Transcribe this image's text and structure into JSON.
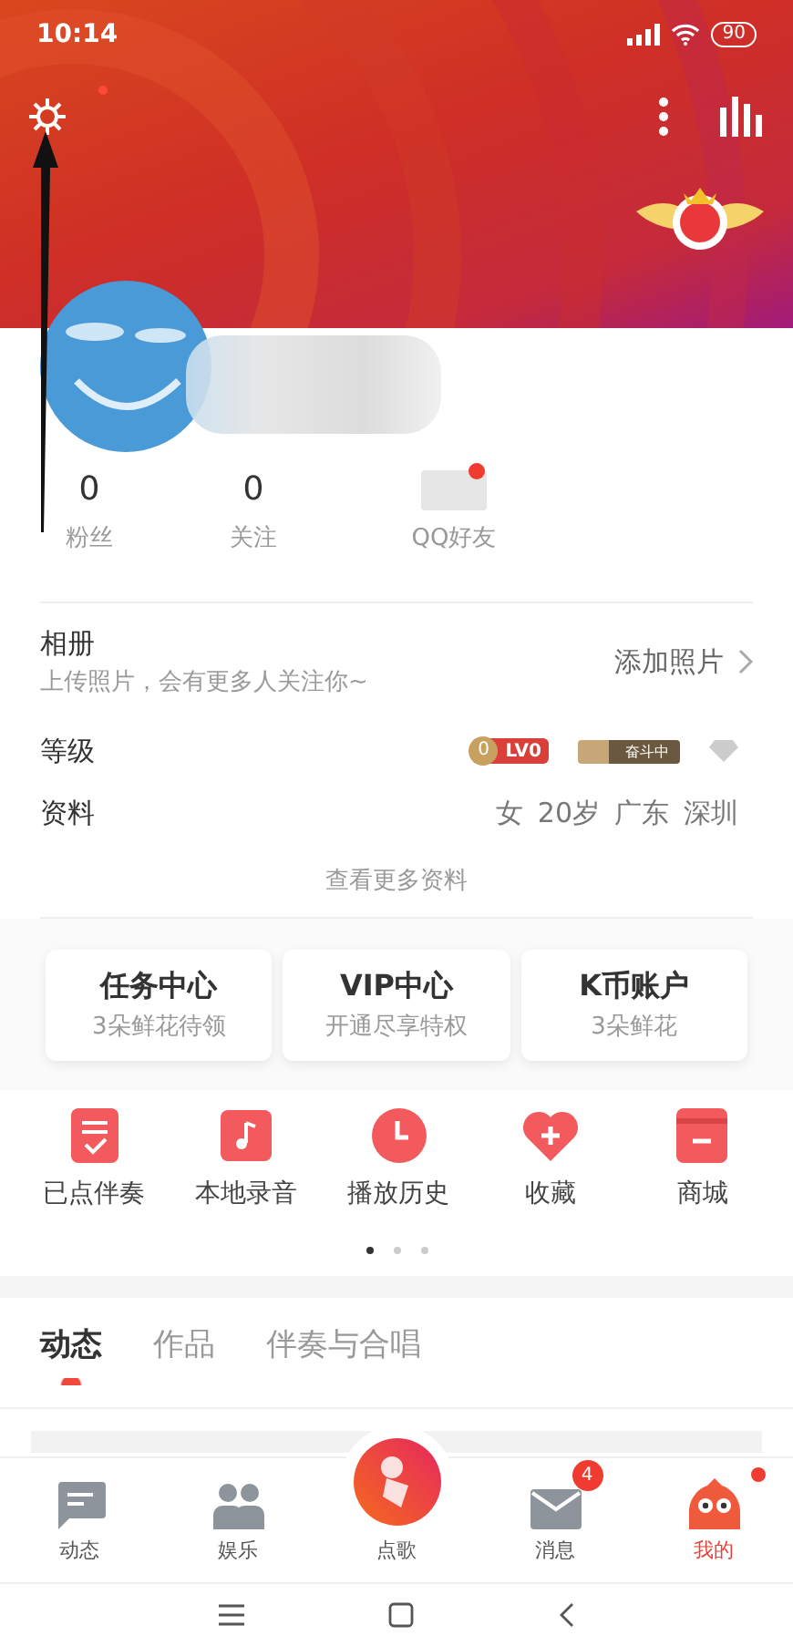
{
  "status_bar": {
    "time": "10:14",
    "battery": "90"
  },
  "header": {
    "settings_badge": true
  },
  "profile": {
    "stats": [
      {
        "value": "0",
        "label": "粉丝"
      },
      {
        "value": "0",
        "label": "关注"
      },
      {
        "label": "QQ好友",
        "badge": true
      }
    ]
  },
  "album": {
    "label": "相册",
    "hint": "上传照片，会有更多人关注你~",
    "action": "添加照片"
  },
  "level": {
    "label": "等级",
    "coin": "0",
    "level_text": "LV0",
    "rank": "奋斗中"
  },
  "info": {
    "label": "资料",
    "values": [
      "女",
      "20岁",
      "广东",
      "深圳"
    ]
  },
  "more_link": "查看更多资料",
  "cards": [
    {
      "title": "任务中心",
      "subtitle": "3朵鲜花待领"
    },
    {
      "title": "VIP中心",
      "subtitle": "开通尽享特权"
    },
    {
      "title": "K币账户",
      "subtitle": "3朵鲜花"
    }
  ],
  "shortcuts": [
    {
      "label": "已点伴奏",
      "kind": "list"
    },
    {
      "label": "本地录音",
      "kind": "music"
    },
    {
      "label": "播放历史",
      "kind": "clock"
    },
    {
      "label": "收藏",
      "kind": "heart"
    },
    {
      "label": "商城",
      "kind": "shop"
    }
  ],
  "pager": [
    {
      "selected": true
    },
    {
      "selected": false
    },
    {
      "selected": false
    }
  ],
  "tabs": [
    {
      "label": "动态",
      "selected": true
    },
    {
      "label": "作品",
      "selected": false
    },
    {
      "label": "伴奏与合唱",
      "selected": false
    }
  ],
  "nav": [
    {
      "label": "动态",
      "kind": "feed",
      "selected": false
    },
    {
      "label": "娱乐",
      "kind": "people",
      "selected": false
    },
    {
      "label": "点歌",
      "kind": "mic",
      "selected": false
    },
    {
      "label": "消息",
      "kind": "mail",
      "selected": false,
      "badge": "4"
    },
    {
      "label": "我的",
      "kind": "me",
      "selected": true,
      "dot": true
    }
  ]
}
